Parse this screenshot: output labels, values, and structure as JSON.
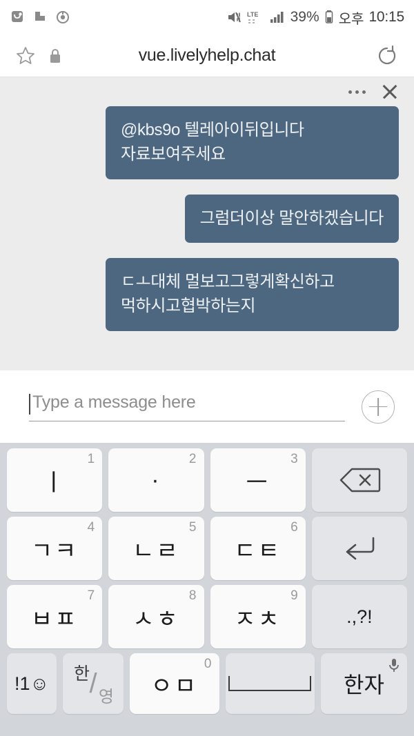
{
  "status_bar": {
    "notification_icons": [
      "app-badge-icon",
      "flag-icon",
      "power-circle-icon"
    ],
    "mute_icon": "mute-icon",
    "network_label": "LTE",
    "signal_icon": "signal-bars-icon",
    "battery_percent": "39%",
    "battery_icon": "battery-icon",
    "am_pm": "오후",
    "clock": "10:15"
  },
  "browser": {
    "bookmark_icon": "star-icon",
    "lock_icon": "lock-icon",
    "url": "vue.livelyhelp.chat",
    "reload_icon": "reload-icon"
  },
  "chat": {
    "menu_icon": "more-options-icon",
    "close_icon": "close-icon",
    "bubble_color": "#4d6781",
    "background_color": "#ececec",
    "messages": [
      {
        "text": "@kbs9o 텔레아이뒤입니다 자료보여주세요",
        "align": "right",
        "width": "wide"
      },
      {
        "text": "그럼더이상 말안하겠습니다",
        "align": "right",
        "width": "narrow"
      },
      {
        "text": "ㄷㅗ대체 멀보고그렇게확신하고 먹하시고협박하는지",
        "align": "right",
        "width": "wide"
      }
    ]
  },
  "composer": {
    "placeholder": "Type a message here",
    "value": "",
    "add_icon": "plus-circle-icon"
  },
  "keyboard": {
    "background_color": "#d2d5da",
    "rows": [
      [
        {
          "label": "ㅣ",
          "num": "1",
          "type": "char",
          "name": "key-i"
        },
        {
          "label": "·",
          "num": "2",
          "type": "char",
          "name": "key-dot"
        },
        {
          "label": "ㅡ",
          "num": "3",
          "type": "char",
          "name": "key-eu"
        },
        {
          "label": "",
          "num": "",
          "type": "fn",
          "name": "backspace-key",
          "icon": "backspace-icon"
        }
      ],
      [
        {
          "label": "ㄱㅋ",
          "num": "4",
          "type": "char",
          "name": "key-giyeok-kieuk"
        },
        {
          "label": "ㄴㄹ",
          "num": "5",
          "type": "char",
          "name": "key-nieun-rieul"
        },
        {
          "label": "ㄷㅌ",
          "num": "6",
          "type": "char",
          "name": "key-digeut-tieut"
        },
        {
          "label": "",
          "num": "",
          "type": "fn",
          "name": "enter-key",
          "icon": "enter-icon"
        }
      ],
      [
        {
          "label": "ㅂㅍ",
          "num": "7",
          "type": "char",
          "name": "key-bieup-pieup"
        },
        {
          "label": "ㅅㅎ",
          "num": "8",
          "type": "char",
          "name": "key-siot-hieut"
        },
        {
          "label": "ㅈㅊ",
          "num": "9",
          "type": "char",
          "name": "key-jieut-chieut"
        },
        {
          "label": ".,?!",
          "num": "",
          "type": "fn",
          "name": "punctuation-key"
        }
      ]
    ],
    "bottom_row": {
      "symbols_label": "!1☺",
      "lang_han": "한",
      "lang_yeong": "영",
      "om_label": "ㅇㅁ",
      "om_num": "0",
      "space_label": "",
      "hanja_label": "한자",
      "mic_icon": "microphone-icon"
    }
  }
}
